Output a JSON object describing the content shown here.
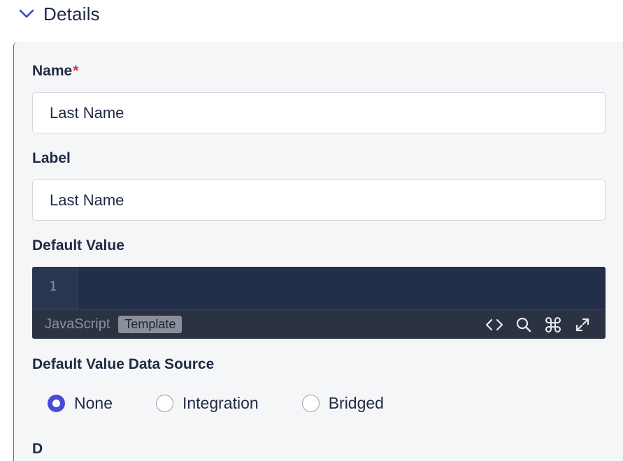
{
  "section": {
    "title": "Details",
    "icon": "chevron-down-icon",
    "accent": "#3b3fc7"
  },
  "form": {
    "name": {
      "label": "Name",
      "required_mark": "*",
      "value": "Last Name"
    },
    "label": {
      "label": "Label",
      "value": "Last Name"
    },
    "default_value": {
      "label": "Default Value",
      "editor": {
        "line_numbers": [
          "1"
        ],
        "language": "JavaScript",
        "mode_tag": "Template",
        "tools": [
          "code-icon",
          "search-icon",
          "command-icon",
          "expand-icon"
        ]
      }
    },
    "data_source": {
      "label": "Default Value Data Source",
      "options": [
        {
          "label": "None",
          "selected": true
        },
        {
          "label": "Integration",
          "selected": false
        },
        {
          "label": "Bridged",
          "selected": false
        }
      ]
    },
    "next_label": "D"
  },
  "colors": {
    "radio_selected": "#4a4ad8",
    "required": "#e0314b",
    "editor_bg": "#232e4b",
    "panel_bg": "#f5f6f8"
  }
}
